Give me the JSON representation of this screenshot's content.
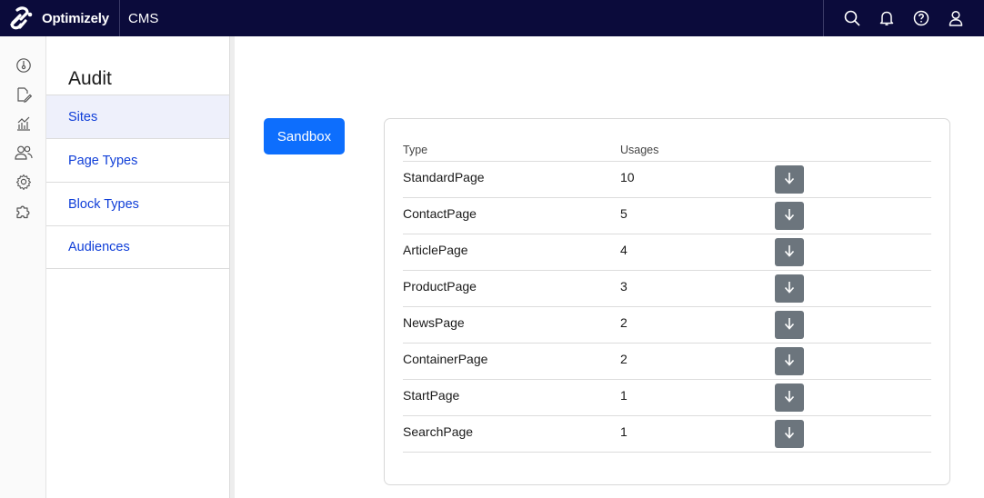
{
  "header": {
    "brand_name": "Optimizely",
    "product": "CMS",
    "icons": [
      "search-icon",
      "bell-icon",
      "help-icon",
      "user-icon"
    ]
  },
  "rail": {
    "icons": [
      "dashboard-icon",
      "edit-icon",
      "reports-icon",
      "users-icon",
      "settings-icon",
      "addons-icon"
    ]
  },
  "subnav": {
    "title": "Audit",
    "items": [
      {
        "label": "Sites",
        "active": true
      },
      {
        "label": "Page Types",
        "active": false
      },
      {
        "label": "Block Types",
        "active": false
      },
      {
        "label": "Audiences",
        "active": false
      }
    ]
  },
  "main": {
    "site_button": "Sandbox",
    "table": {
      "headers": [
        "Type",
        "Usages"
      ],
      "rows": [
        {
          "type": "StandardPage",
          "usages": "10"
        },
        {
          "type": "ContactPage",
          "usages": "5"
        },
        {
          "type": "ArticlePage",
          "usages": "4"
        },
        {
          "type": "ProductPage",
          "usages": "3"
        },
        {
          "type": "NewsPage",
          "usages": "2"
        },
        {
          "type": "ContainerPage",
          "usages": "2"
        },
        {
          "type": "StartPage",
          "usages": "1"
        },
        {
          "type": "SearchPage",
          "usages": "1"
        }
      ],
      "row_action_icon": "arrow-down-icon"
    }
  },
  "colors": {
    "topbar": "#0b0b3b",
    "primary": "#0d6efd",
    "link": "#0f3ed8",
    "action_button": "#6c757d",
    "active_nav_bg": "#eef0fb"
  }
}
